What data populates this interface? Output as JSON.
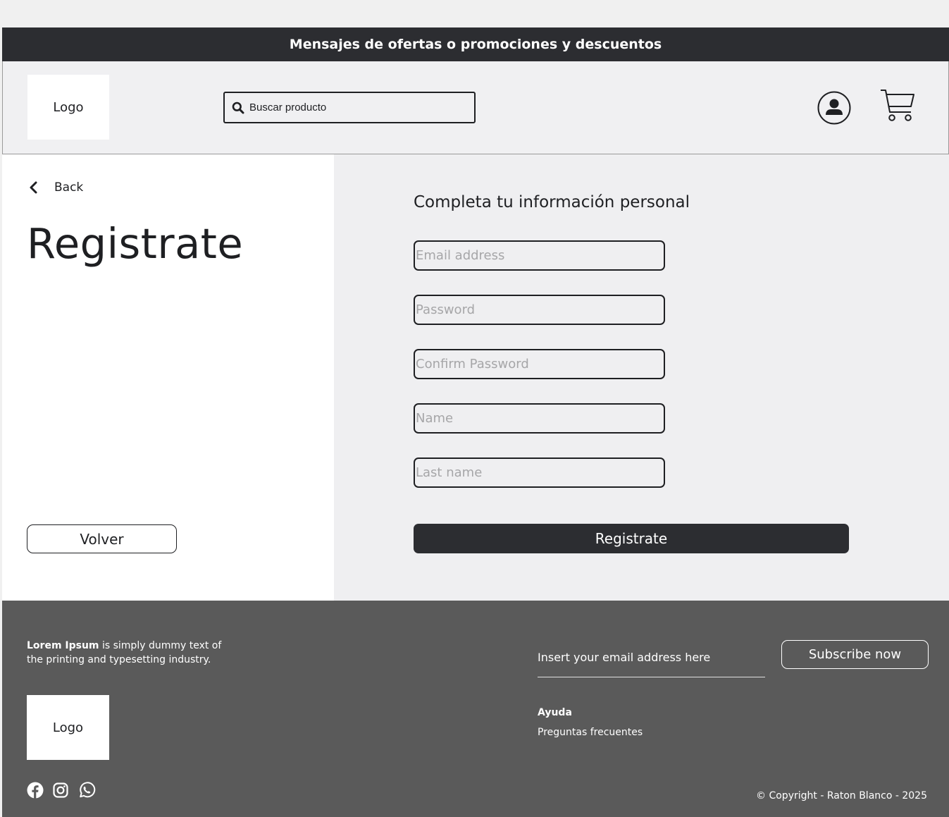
{
  "promo_bar": {
    "text": "Mensajes de ofertas o promociones y descuentos"
  },
  "header": {
    "logo": "Logo",
    "search": {
      "placeholder": "Buscar producto",
      "icon": "search-icon"
    },
    "user_icon": "user-icon",
    "cart_icon": "cart-icon"
  },
  "left": {
    "back_label": "Back",
    "title": "Registrate",
    "volver_label": "Volver"
  },
  "form": {
    "heading": "Completa tu información personal",
    "email_placeholder": "Email address",
    "password_placeholder": "Password",
    "confirm_placeholder": "Confirm Password",
    "name_placeholder": "Name",
    "lastname_placeholder": "Last name",
    "submit_label": "Registrate"
  },
  "footer": {
    "desc_bold": "Lorem Ipsum",
    "desc_rest": " is simply dummy text of the printing and typesetting industry.",
    "logo": "Logo",
    "socials": [
      "facebook-icon",
      "instagram-icon",
      "whatsapp-icon"
    ],
    "newsletter_placeholder": "Insert your email address here",
    "subscribe_label": "Subscribe now",
    "help_title": "Ayuda",
    "help_link": "Preguntas frecuentes",
    "copyright": "© Copyright - Raton Blanco - 2025"
  }
}
